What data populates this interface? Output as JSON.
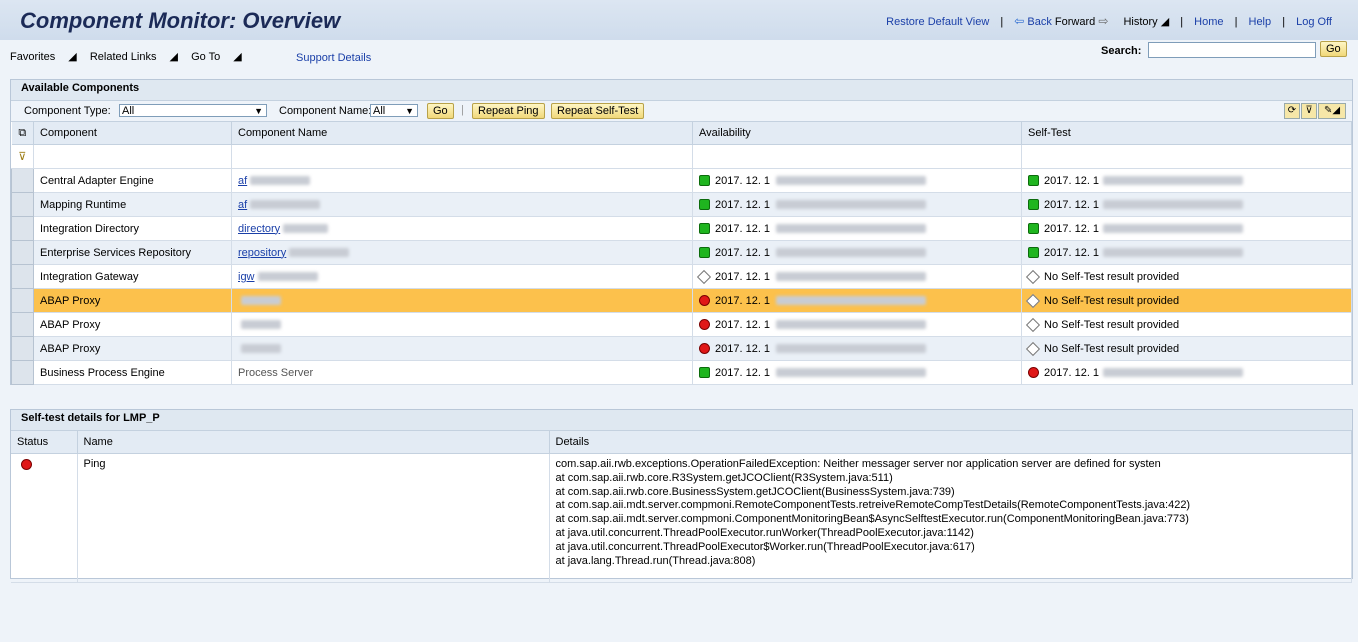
{
  "header": {
    "title": "Component Monitor: Overview",
    "restore": "Restore Default View",
    "back": "Back",
    "forward": "Forward",
    "history": "History",
    "home": "Home",
    "help": "Help",
    "logoff": "Log Off"
  },
  "nav": {
    "favorites": "Favorites",
    "related": "Related Links",
    "goto": "Go To",
    "support": "Support Details",
    "search_label": "Search:",
    "search_value": "",
    "go": "Go"
  },
  "components": {
    "title": "Available Components",
    "type_label": "Component Type:",
    "type_value": "All",
    "name_label": "Component Name:",
    "name_value": "All",
    "go": "Go",
    "repeat_ping": "Repeat Ping",
    "repeat_selftest": "Repeat Self-Test",
    "columns": [
      "Component",
      "Component Name",
      "Availability",
      "Self-Test"
    ],
    "rows": [
      {
        "component": "Central Adapter Engine",
        "name": "af",
        "avail": "2017. 12. 1",
        "avail_status": "green",
        "self": "2017. 12. 1",
        "self_status": "green"
      },
      {
        "component": "Mapping Runtime",
        "name": "af",
        "avail": "2017. 12. 1",
        "avail_status": "green",
        "self": "2017. 12. 1",
        "self_status": "green"
      },
      {
        "component": "Integration Directory",
        "name": "directory",
        "avail": "2017. 12. 1",
        "avail_status": "green",
        "self": "2017. 12. 1",
        "self_status": "green"
      },
      {
        "component": "Enterprise Services Repository",
        "name": "repository",
        "avail": "2017. 12. 1",
        "avail_status": "green",
        "self": "2017. 12. 1",
        "self_status": "green"
      },
      {
        "component": "Integration Gateway",
        "name": "igw",
        "avail": "2017. 12. 1",
        "avail_status": "none",
        "self": "No Self-Test result provided",
        "self_status": "none"
      },
      {
        "component": "ABAP Proxy",
        "name": "",
        "avail": "2017. 12. 1",
        "avail_status": "red",
        "self": "No Self-Test result provided",
        "self_status": "none"
      },
      {
        "component": "ABAP Proxy",
        "name": "",
        "avail": "2017. 12. 1",
        "avail_status": "red",
        "self": "No Self-Test result provided",
        "self_status": "none"
      },
      {
        "component": "ABAP Proxy",
        "name": "",
        "avail": "2017. 12. 1",
        "avail_status": "red",
        "self": "No Self-Test result provided",
        "self_status": "none"
      },
      {
        "component": "Business Process Engine",
        "name": "Process Server",
        "avail": "2017. 12. 1",
        "avail_status": "green",
        "self": "2017. 12. 1",
        "self_status": "red"
      }
    ]
  },
  "details": {
    "title": "Self-test details for LMP_P",
    "columns": [
      "Status",
      "Name",
      "Details"
    ],
    "row_name": "Ping",
    "lines": [
      "com.sap.aii.rwb.exceptions.OperationFailedException: Neither messager server nor application server are defined for systen",
      "at com.sap.aii.rwb.core.R3System.getJCOClient(R3System.java:511)",
      "at com.sap.aii.rwb.core.BusinessSystem.getJCOClient(BusinessSystem.java:739)",
      "at com.sap.aii.mdt.server.compmoni.RemoteComponentTests.retreiveRemoteCompTestDetails(RemoteComponentTests.java:422)",
      "at com.sap.aii.mdt.server.compmoni.ComponentMonitoringBean$AsyncSelftestExecutor.run(ComponentMonitoringBean.java:773)",
      "at java.util.concurrent.ThreadPoolExecutor.runWorker(ThreadPoolExecutor.java:1142)",
      "at java.util.concurrent.ThreadPoolExecutor$Worker.run(ThreadPoolExecutor.java:617)",
      "at java.lang.Thread.run(Thread.java:808)"
    ]
  }
}
